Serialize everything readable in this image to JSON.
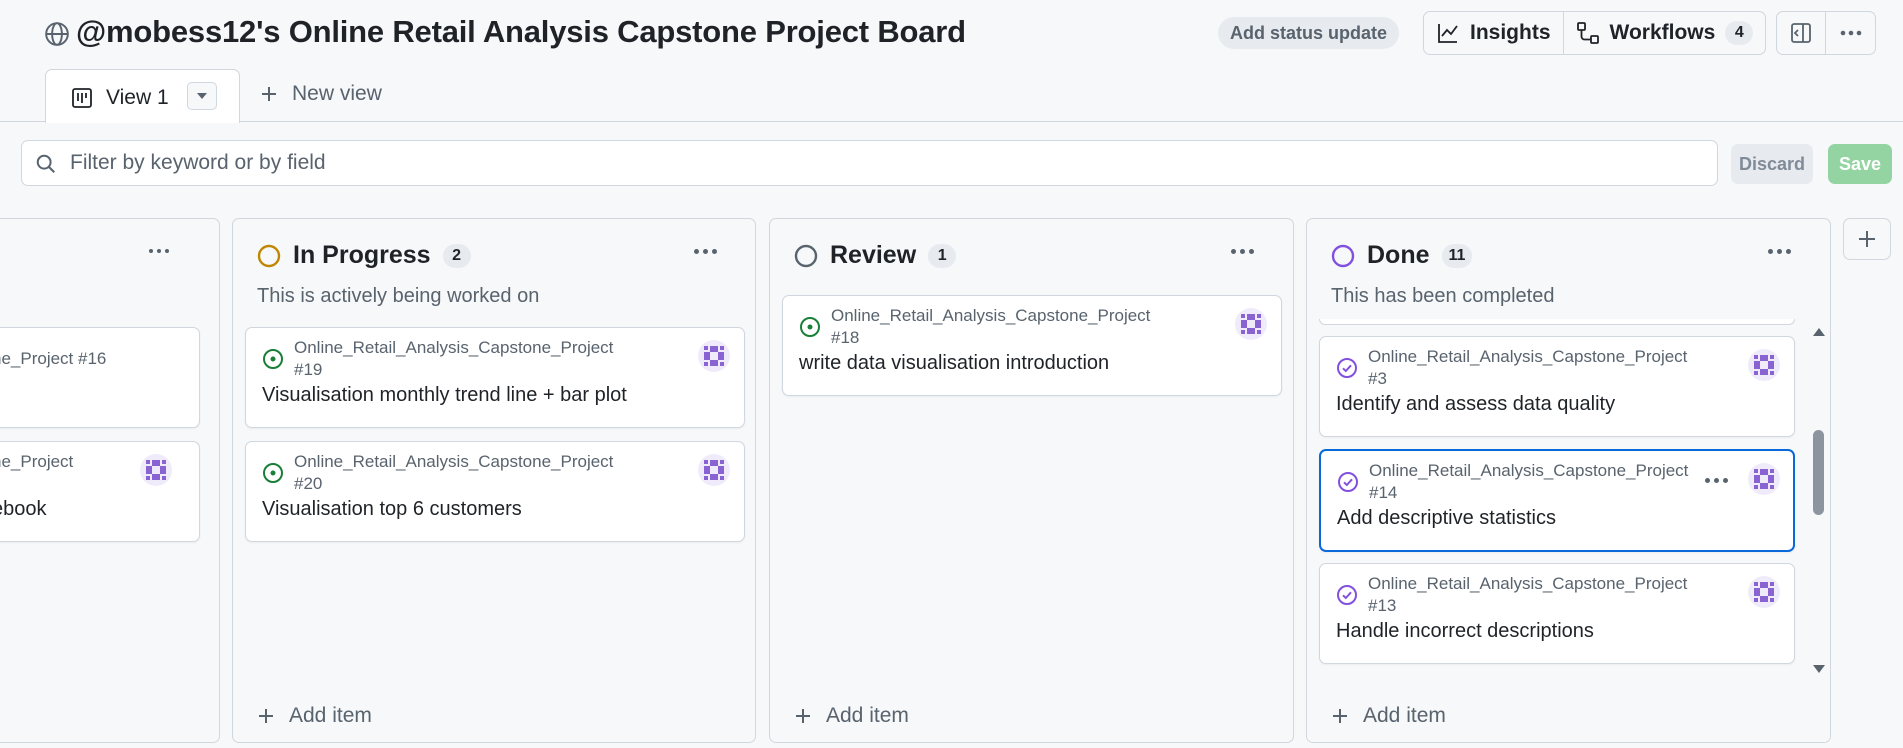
{
  "header": {
    "title": "@mobess12's Online Retail Analysis Capstone Project Board",
    "status_update": "Add status update",
    "insights": "Insights",
    "workflows": "Workflows",
    "workflows_count": "4"
  },
  "tabs": {
    "active": "View 1",
    "new_view": "New view"
  },
  "filter": {
    "placeholder": "Filter by keyword or by field",
    "discard": "Discard",
    "save": "Save"
  },
  "columns": {
    "left": {
      "cards": [
        {
          "repo": "ne_Project #16",
          "title": ""
        },
        {
          "repo": "ne_Project",
          "title": "ebook"
        }
      ]
    },
    "in_progress": {
      "name": "In Progress",
      "count": "2",
      "description": "This is actively being worked on",
      "status_color": "#bf8700",
      "cards": [
        {
          "repo": "Online_Retail_Analysis_Capstone_Project",
          "number": "#19",
          "title": "Visualisation monthly trend line + bar plot"
        },
        {
          "repo": "Online_Retail_Analysis_Capstone_Project",
          "number": "#20",
          "title": "Visualisation top 6 customers"
        }
      ],
      "add_item": "Add item"
    },
    "review": {
      "name": "Review",
      "count": "1",
      "status_color": "#59636e",
      "cards": [
        {
          "repo": "Online_Retail_Analysis_Capstone_Project",
          "number": "#18",
          "title": "write data visualisation introduction"
        }
      ],
      "add_item": "Add item"
    },
    "done": {
      "name": "Done",
      "count": "11",
      "description": "This has been completed",
      "status_color": "#8250df",
      "cards": [
        {
          "repo": "Online_Retail_Analysis_Capstone_Project",
          "number": "#3",
          "title": "Identify and assess data quality"
        },
        {
          "repo": "Online_Retail_Analysis_Capstone_Project",
          "number": "#14",
          "title": "Add descriptive statistics"
        },
        {
          "repo": "Online_Retail_Analysis_Capstone_Project",
          "number": "#13",
          "title": "Handle incorrect descriptions"
        }
      ],
      "add_item": "Add item"
    }
  },
  "colors": {
    "open_issue": "#1a7f37",
    "closed_issue": "#8250df",
    "focus": "#0969da",
    "avatar": "#8a63d2"
  },
  "icons": {
    "globe": "globe-icon",
    "insights": "graph-icon",
    "workflows": "workflow-icon",
    "sidebar": "sidebar-icon",
    "more": "kebab-horizontal-icon",
    "board": "project-board-icon",
    "plus": "plus-icon",
    "search": "search-icon"
  }
}
